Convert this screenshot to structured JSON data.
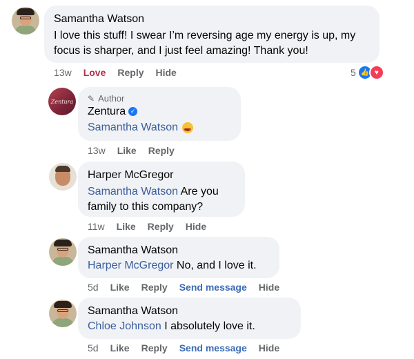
{
  "comment1": {
    "name": "Samantha Watson",
    "text": "I love this stuff! I swear I’m reversing age my energy is up, my focus is sharper, and I just feel amazing! Thank you!",
    "time": "13w",
    "love": "Love",
    "reply": "Reply",
    "hide": "Hide",
    "reaction_count": "5"
  },
  "reply1": {
    "badge": "Author",
    "name": "Zentura",
    "avatar_text": "Zentura",
    "mention": "Samantha Watson",
    "time": "13w",
    "like": "Like",
    "reply": "Reply"
  },
  "reply2": {
    "name": "Harper McGregor",
    "mention": "Samantha Watson",
    "text": " Are you family to this company?",
    "time": "11w",
    "like": "Like",
    "reply": "Reply",
    "hide": "Hide"
  },
  "reply3": {
    "name": "Samantha Watson",
    "mention": "Harper McGregor",
    "text": " No, and I love it.",
    "time": "5d",
    "like": "Like",
    "reply": "Reply",
    "send": "Send message",
    "hide": "Hide"
  },
  "reply4": {
    "name": "Samantha Watson",
    "mention": "Chloe Johnson",
    "text": " I absolutely love it.",
    "time": "5d",
    "like": "Like",
    "reply": "Reply",
    "send": "Send message",
    "hide": "Hide"
  }
}
